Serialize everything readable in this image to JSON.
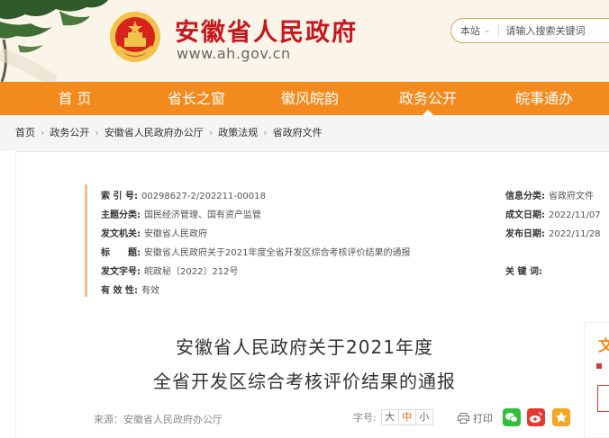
{
  "header": {
    "site_title": "安徽省人民政府",
    "site_url": "www.ah.gov.cn",
    "search_scope": "本站",
    "search_placeholder": "请输入搜索关键词"
  },
  "nav": {
    "items": [
      "首 页",
      "省长之窗",
      "徽风皖韵",
      "政务公开",
      "皖事通办"
    ],
    "active_index": 3
  },
  "breadcrumb": [
    "首页",
    "政务公开",
    "安徽省人民政府办公厅",
    "政策法规",
    "省政府文件"
  ],
  "meta": {
    "index_no_label": "索 引 号:",
    "index_no": "00298627-2/202211-00018",
    "category_label": "信息分类:",
    "category": "省政府文件",
    "topic_label": "主题分类:",
    "topic": "国民经济管理、国有资产监管",
    "created_label": "成文日期:",
    "created": "2022/11/07",
    "issuer_label": "发文机关:",
    "issuer": "安徽省人民政府",
    "published_label": "发布日期:",
    "published": "2022/11/28",
    "title_label": "标　　题:",
    "title": "安徽省人民政府关于2021年度全省开发区综合考核评价结果的通报",
    "doc_no_label": "发文字号:",
    "doc_no": "皖政秘〔2022〕212号",
    "keywords_label": "关 键 词:",
    "validity_label": "有 效 性:",
    "validity": "有效"
  },
  "article": {
    "title_line1": "安徽省人民政府关于2021年度",
    "title_line2": "全省开发区综合考核评价结果的通报",
    "source": "来源：安徽省人民政府办公厅",
    "font_label": "字号:",
    "font_large": "大",
    "font_medium": "中",
    "font_small": "小",
    "print": "打印"
  },
  "side": {
    "text": "文"
  },
  "colors": {
    "nav": "#f28a1d",
    "title_red": "#c8161d",
    "accent_gold": "#e8c28a"
  }
}
